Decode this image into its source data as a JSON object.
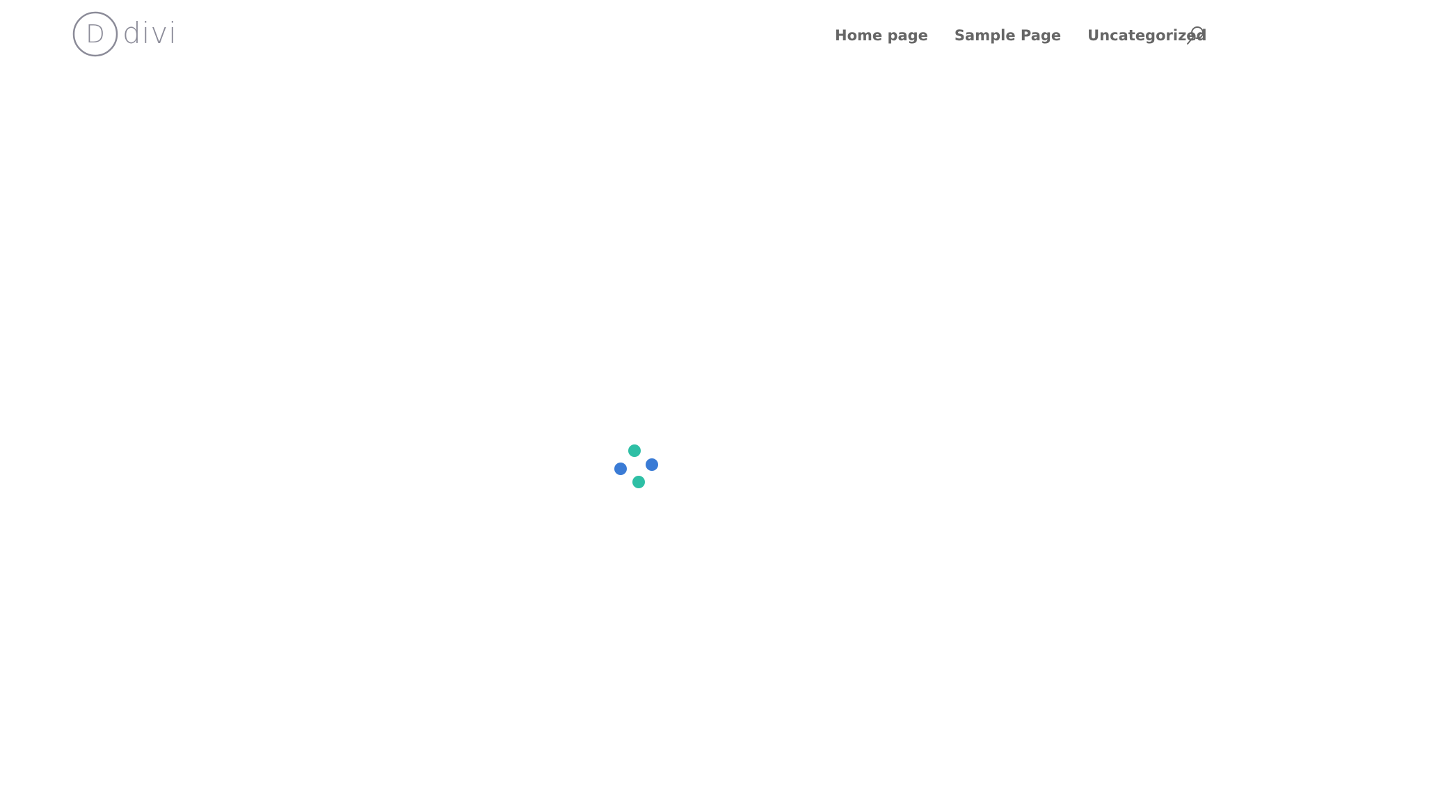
{
  "header": {
    "logo": {
      "letter": "D",
      "text": "divi",
      "color": "#8b8b98"
    },
    "nav": {
      "items": [
        {
          "label": "Home page"
        },
        {
          "label": "Sample Page"
        },
        {
          "label": "Uncategorized"
        }
      ]
    },
    "search": {
      "icon": "search-icon"
    }
  },
  "loader": {
    "icon": "loading-spinner-icon",
    "colors": {
      "teal": "#2ebfa5",
      "blue": "#3a7bd5"
    }
  },
  "colors": {
    "nav_text": "#666666",
    "background": "#ffffff"
  }
}
